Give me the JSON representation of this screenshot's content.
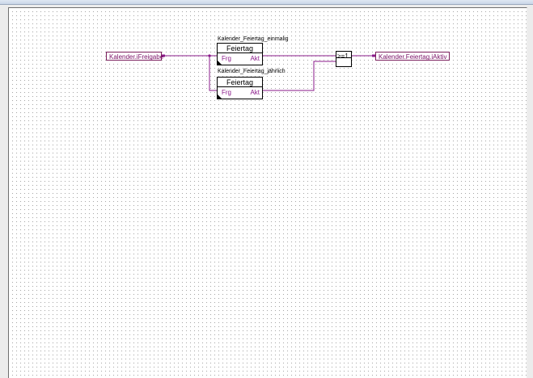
{
  "diagram": {
    "input_variable": "Kalender.iFreigabe",
    "output_variable": "Kalender.Feiertag.iAktiv",
    "blocks": [
      {
        "instance": "Kalender_Feiertag_einmalig",
        "type": "Feiertag",
        "input": "Frg",
        "output": "Akt"
      },
      {
        "instance": "Kalender_Feiertag_jährlich",
        "type": "Feiertag",
        "input": "Frg",
        "output": "Akt"
      }
    ],
    "or_gate": {
      "label": ">=1"
    }
  },
  "colors": {
    "wire": "#8a1a8a",
    "variable_border": "#7a1f5c",
    "grid_dot": "#a8a8a8",
    "canvas": "#ffffff"
  }
}
